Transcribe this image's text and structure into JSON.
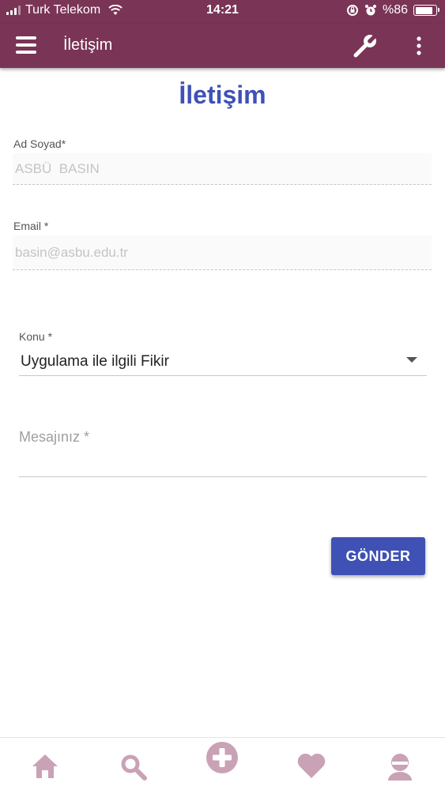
{
  "status_bar": {
    "carrier": "Turk Telekom",
    "time": "14:21",
    "battery_text": "%86",
    "battery_level": 0.86
  },
  "app_bar": {
    "title": "İletişim",
    "icons": [
      "menu-icon",
      "wrench-icon",
      "more-vert-icon"
    ]
  },
  "form": {
    "heading": "İletişim",
    "name": {
      "label": "Ad Soyad*",
      "value": "ASBÜ  BASIN"
    },
    "email": {
      "label": "Email *",
      "value": "basin@asbu.edu.tr"
    },
    "subject": {
      "label": "Konu *",
      "selected": "Uygulama ile ilgili Fikir"
    },
    "message": {
      "placeholder": "Mesajınız *"
    },
    "submit_label": "GÖNDER"
  },
  "bottom_nav": {
    "items": [
      "home-icon",
      "search-icon",
      "add-icon",
      "favorite-icon",
      "profile-icon"
    ]
  },
  "colors": {
    "primary": "#7a3456",
    "accent": "#3f51b5",
    "nav_icon": "#c9a2b6"
  }
}
